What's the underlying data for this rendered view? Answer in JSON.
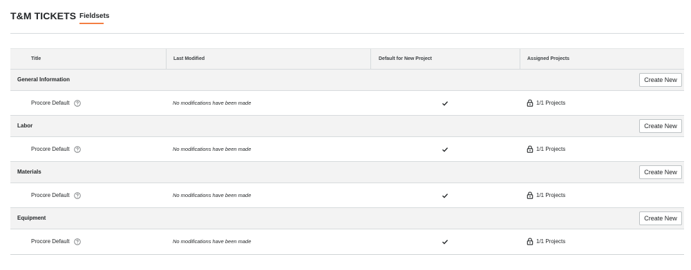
{
  "header": {
    "title": "T&M TICKETS",
    "tabs": [
      {
        "label": "Fieldsets",
        "active": true
      }
    ]
  },
  "table": {
    "columns": [
      "Title",
      "Last Modified",
      "Default for New Project",
      "Assigned Projects"
    ],
    "groups": [
      {
        "title": "General Information",
        "create_label": "Create New",
        "items": [
          {
            "name": "Procore Default",
            "modified": "No modifications have been made",
            "is_default": true,
            "projects": "1/1 Projects"
          }
        ]
      },
      {
        "title": "Labor",
        "create_label": "Create New",
        "items": [
          {
            "name": "Procore Default",
            "modified": "No modifications have been made",
            "is_default": true,
            "projects": "1/1 Projects"
          }
        ]
      },
      {
        "title": "Materials",
        "create_label": "Create New",
        "items": [
          {
            "name": "Procore Default",
            "modified": "No modifications have been made",
            "is_default": true,
            "projects": "1/1 Projects"
          }
        ]
      },
      {
        "title": "Equipment",
        "create_label": "Create New",
        "items": [
          {
            "name": "Procore Default",
            "modified": "No modifications have been made",
            "is_default": true,
            "projects": "1/1 Projects"
          }
        ]
      }
    ]
  },
  "icons": {
    "help": "help-circle-icon",
    "default": "checkmark-icon",
    "projects": "lock-icon"
  },
  "colors": {
    "accent": "#f47e42",
    "header_bg": "#f3f3f3",
    "border": "#d6dadc",
    "text": "#232628"
  }
}
